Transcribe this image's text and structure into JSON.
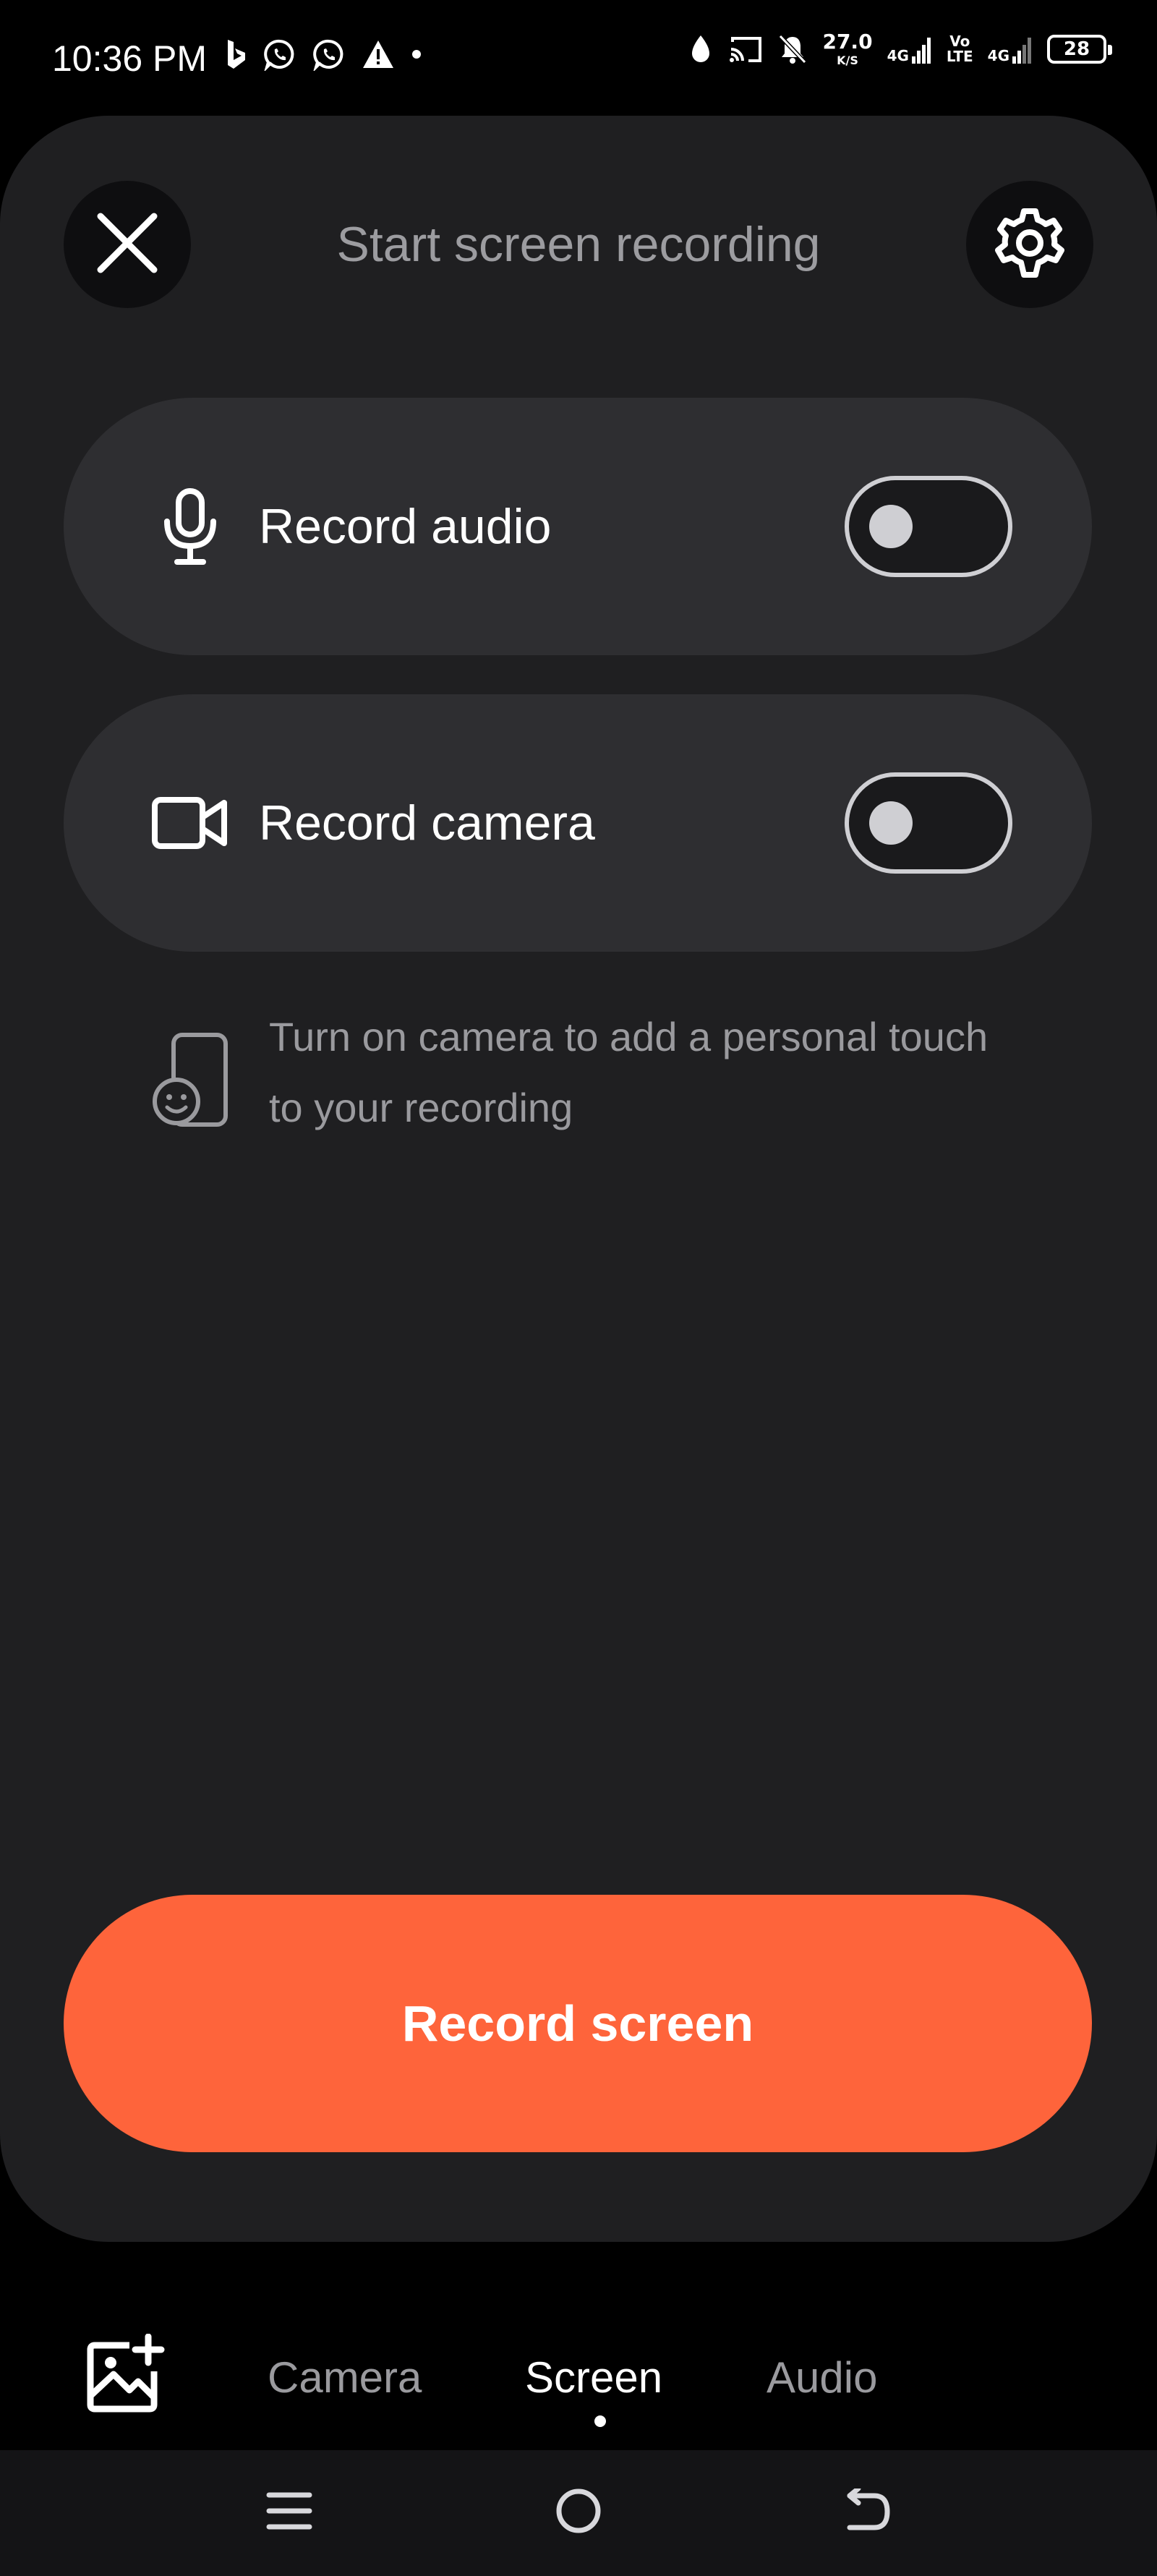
{
  "status_bar": {
    "time": "10:36 PM",
    "network_speed_value": "27.0",
    "network_speed_unit": "K/S",
    "sim1_label": "4G",
    "volte_label": "Vo\nLTE",
    "sim2_label": "4G",
    "battery_level": "28",
    "icons": [
      "bing-icon",
      "whatsapp-icon",
      "whatsapp-icon",
      "warning-icon",
      "dot-icon",
      "data-saver-icon",
      "cast-icon",
      "bell-off-icon",
      "signal-icon",
      "battery-icon"
    ]
  },
  "sheet": {
    "title": "Start screen recording",
    "close_icon": "close-icon",
    "settings_icon": "gear-icon",
    "options": [
      {
        "label": "Record audio",
        "icon": "microphone-icon",
        "enabled": false
      },
      {
        "label": "Record camera",
        "icon": "video-camera-icon",
        "enabled": false
      }
    ],
    "hint_text": "Turn on camera to add a personal touch to your recording",
    "hint_icon": "phone-face-icon",
    "record_button_label": "Record screen",
    "colors": {
      "accent": "#fe643b",
      "sheet_background": "#1f1f21",
      "row_background": "#2e2e31"
    }
  },
  "tab_bar": {
    "gallery_icon": "add-image-icon",
    "tabs": [
      "Camera",
      "Screen",
      "Audio"
    ],
    "active_tab": "Screen"
  },
  "nav_bar": {
    "icons": [
      "menu-icon",
      "home-icon",
      "back-icon"
    ]
  }
}
